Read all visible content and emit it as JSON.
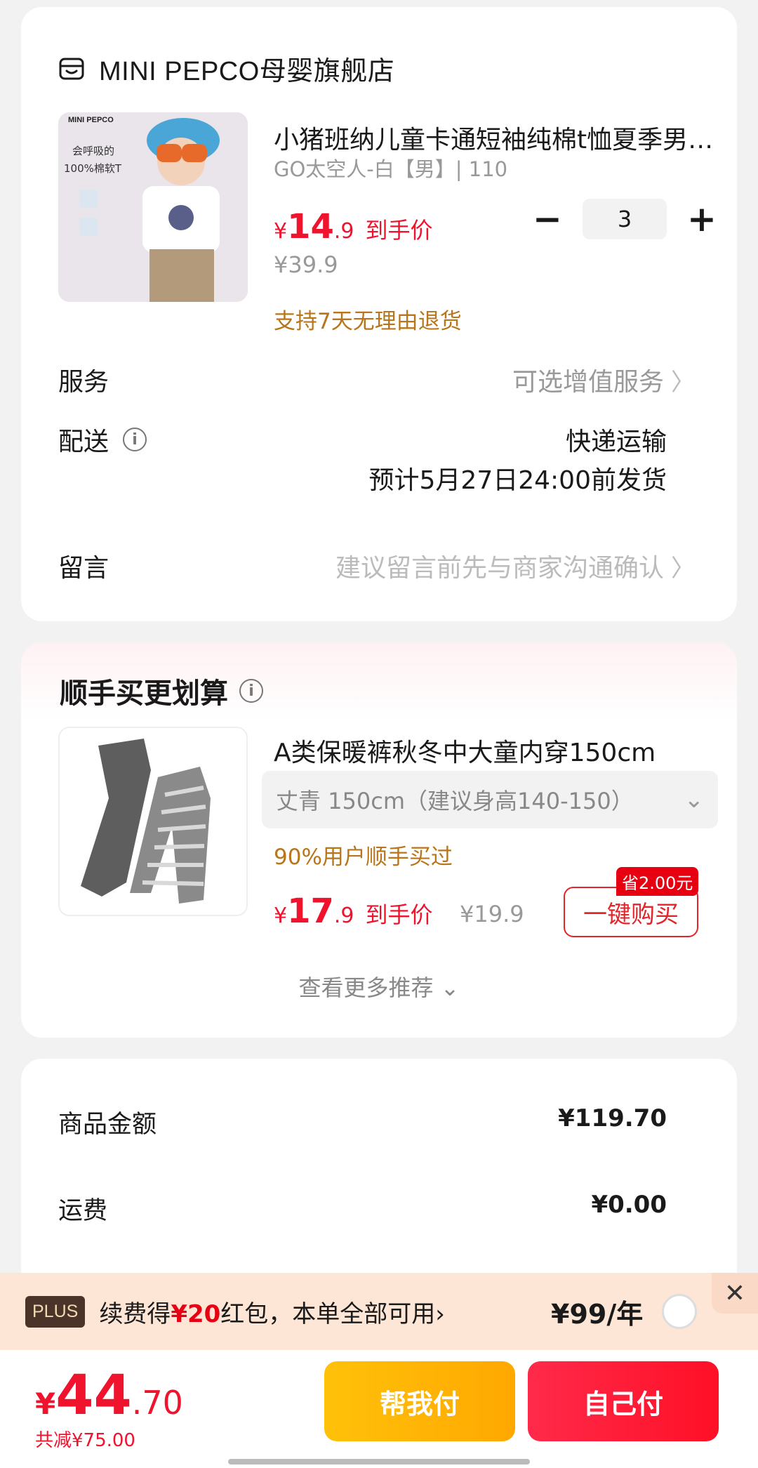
{
  "shop": {
    "name": "MINI PEPCO母婴旗舰店"
  },
  "product": {
    "thumb_brand": "MINI PEPCO",
    "thumb_text": "会呼吸的 100%棉软T",
    "title": "小猪班纳儿童卡通短袖纯棉t恤夏季男童上衣",
    "spec": "GO太空人-白【男】| 110",
    "price_currency": "¥",
    "price_int": "14",
    "price_dec": ".9",
    "price_tag": "到手价",
    "orig_price": "¥39.9",
    "return_policy": "支持7天无理由退货",
    "quantity": "3",
    "minus": "−",
    "plus": "+"
  },
  "service": {
    "label": "服务",
    "value": "可选增值服务",
    "chevron": "〉"
  },
  "shipping": {
    "label": "配送",
    "info": "i",
    "method": "快递运输",
    "eta": "预计5月27日24:00前发货"
  },
  "message": {
    "label": "留言",
    "placeholder": "建议留言前先与商家沟通确认",
    "chevron": "〉"
  },
  "recommend": {
    "title": "顺手买更划算",
    "info": "i",
    "product_title": "A类保暖裤秋冬中大童内穿150cm",
    "spec": "丈青   150cm（建议身高140-150）",
    "spec_chevron": "⌄",
    "popularity": "90%用户顺手买过",
    "price_currency": "¥",
    "price_int": "17",
    "price_dec": ".9",
    "price_tag": "到手价",
    "orig_price": "¥19.9",
    "save_badge": "省2.00元",
    "buy_label": "一键购买",
    "more": "查看更多推荐 ⌄"
  },
  "summary": {
    "goods_label": "商品金额",
    "goods_value": "¥119.70",
    "freight_label": "运费",
    "freight_value": "¥0.00"
  },
  "plus_banner": {
    "badge": "PLUS",
    "text_prefix": "续费得",
    "text_amount": "¥20",
    "text_suffix": "红包，本单全部可用",
    "text_chevron": "›",
    "price": "¥99/年",
    "close": "✕"
  },
  "checkout": {
    "currency": "¥",
    "total_int": "44",
    "total_dec": ".70",
    "saved": "共减¥75.00",
    "help_pay": "帮我付",
    "self_pay": "自己付"
  },
  "colors": {
    "accent_red": "#f0132e",
    "pay_yellow": "#ffb400",
    "return_orange": "#b8751a"
  }
}
